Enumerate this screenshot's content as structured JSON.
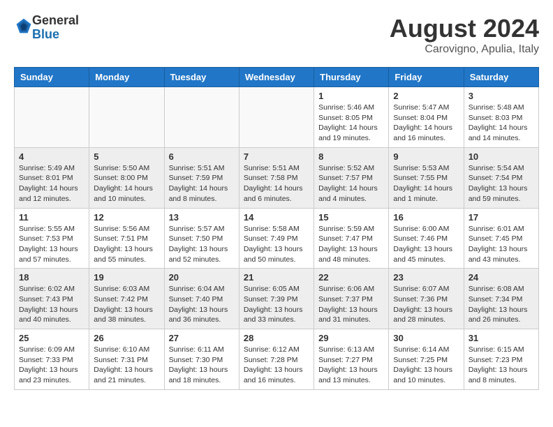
{
  "logo": {
    "general": "General",
    "blue": "Blue"
  },
  "title": "August 2024",
  "location": "Carovigno, Apulia, Italy",
  "days_of_week": [
    "Sunday",
    "Monday",
    "Tuesday",
    "Wednesday",
    "Thursday",
    "Friday",
    "Saturday"
  ],
  "weeks": [
    [
      {
        "day": "",
        "info": ""
      },
      {
        "day": "",
        "info": ""
      },
      {
        "day": "",
        "info": ""
      },
      {
        "day": "",
        "info": ""
      },
      {
        "day": "1",
        "info": "Sunrise: 5:46 AM\nSunset: 8:05 PM\nDaylight: 14 hours\nand 19 minutes."
      },
      {
        "day": "2",
        "info": "Sunrise: 5:47 AM\nSunset: 8:04 PM\nDaylight: 14 hours\nand 16 minutes."
      },
      {
        "day": "3",
        "info": "Sunrise: 5:48 AM\nSunset: 8:03 PM\nDaylight: 14 hours\nand 14 minutes."
      }
    ],
    [
      {
        "day": "4",
        "info": "Sunrise: 5:49 AM\nSunset: 8:01 PM\nDaylight: 14 hours\nand 12 minutes."
      },
      {
        "day": "5",
        "info": "Sunrise: 5:50 AM\nSunset: 8:00 PM\nDaylight: 14 hours\nand 10 minutes."
      },
      {
        "day": "6",
        "info": "Sunrise: 5:51 AM\nSunset: 7:59 PM\nDaylight: 14 hours\nand 8 minutes."
      },
      {
        "day": "7",
        "info": "Sunrise: 5:51 AM\nSunset: 7:58 PM\nDaylight: 14 hours\nand 6 minutes."
      },
      {
        "day": "8",
        "info": "Sunrise: 5:52 AM\nSunset: 7:57 PM\nDaylight: 14 hours\nand 4 minutes."
      },
      {
        "day": "9",
        "info": "Sunrise: 5:53 AM\nSunset: 7:55 PM\nDaylight: 14 hours\nand 1 minute."
      },
      {
        "day": "10",
        "info": "Sunrise: 5:54 AM\nSunset: 7:54 PM\nDaylight: 13 hours\nand 59 minutes."
      }
    ],
    [
      {
        "day": "11",
        "info": "Sunrise: 5:55 AM\nSunset: 7:53 PM\nDaylight: 13 hours\nand 57 minutes."
      },
      {
        "day": "12",
        "info": "Sunrise: 5:56 AM\nSunset: 7:51 PM\nDaylight: 13 hours\nand 55 minutes."
      },
      {
        "day": "13",
        "info": "Sunrise: 5:57 AM\nSunset: 7:50 PM\nDaylight: 13 hours\nand 52 minutes."
      },
      {
        "day": "14",
        "info": "Sunrise: 5:58 AM\nSunset: 7:49 PM\nDaylight: 13 hours\nand 50 minutes."
      },
      {
        "day": "15",
        "info": "Sunrise: 5:59 AM\nSunset: 7:47 PM\nDaylight: 13 hours\nand 48 minutes."
      },
      {
        "day": "16",
        "info": "Sunrise: 6:00 AM\nSunset: 7:46 PM\nDaylight: 13 hours\nand 45 minutes."
      },
      {
        "day": "17",
        "info": "Sunrise: 6:01 AM\nSunset: 7:45 PM\nDaylight: 13 hours\nand 43 minutes."
      }
    ],
    [
      {
        "day": "18",
        "info": "Sunrise: 6:02 AM\nSunset: 7:43 PM\nDaylight: 13 hours\nand 40 minutes."
      },
      {
        "day": "19",
        "info": "Sunrise: 6:03 AM\nSunset: 7:42 PM\nDaylight: 13 hours\nand 38 minutes."
      },
      {
        "day": "20",
        "info": "Sunrise: 6:04 AM\nSunset: 7:40 PM\nDaylight: 13 hours\nand 36 minutes."
      },
      {
        "day": "21",
        "info": "Sunrise: 6:05 AM\nSunset: 7:39 PM\nDaylight: 13 hours\nand 33 minutes."
      },
      {
        "day": "22",
        "info": "Sunrise: 6:06 AM\nSunset: 7:37 PM\nDaylight: 13 hours\nand 31 minutes."
      },
      {
        "day": "23",
        "info": "Sunrise: 6:07 AM\nSunset: 7:36 PM\nDaylight: 13 hours\nand 28 minutes."
      },
      {
        "day": "24",
        "info": "Sunrise: 6:08 AM\nSunset: 7:34 PM\nDaylight: 13 hours\nand 26 minutes."
      }
    ],
    [
      {
        "day": "25",
        "info": "Sunrise: 6:09 AM\nSunset: 7:33 PM\nDaylight: 13 hours\nand 23 minutes."
      },
      {
        "day": "26",
        "info": "Sunrise: 6:10 AM\nSunset: 7:31 PM\nDaylight: 13 hours\nand 21 minutes."
      },
      {
        "day": "27",
        "info": "Sunrise: 6:11 AM\nSunset: 7:30 PM\nDaylight: 13 hours\nand 18 minutes."
      },
      {
        "day": "28",
        "info": "Sunrise: 6:12 AM\nSunset: 7:28 PM\nDaylight: 13 hours\nand 16 minutes."
      },
      {
        "day": "29",
        "info": "Sunrise: 6:13 AM\nSunset: 7:27 PM\nDaylight: 13 hours\nand 13 minutes."
      },
      {
        "day": "30",
        "info": "Sunrise: 6:14 AM\nSunset: 7:25 PM\nDaylight: 13 hours\nand 10 minutes."
      },
      {
        "day": "31",
        "info": "Sunrise: 6:15 AM\nSunset: 7:23 PM\nDaylight: 13 hours\nand 8 minutes."
      }
    ]
  ]
}
